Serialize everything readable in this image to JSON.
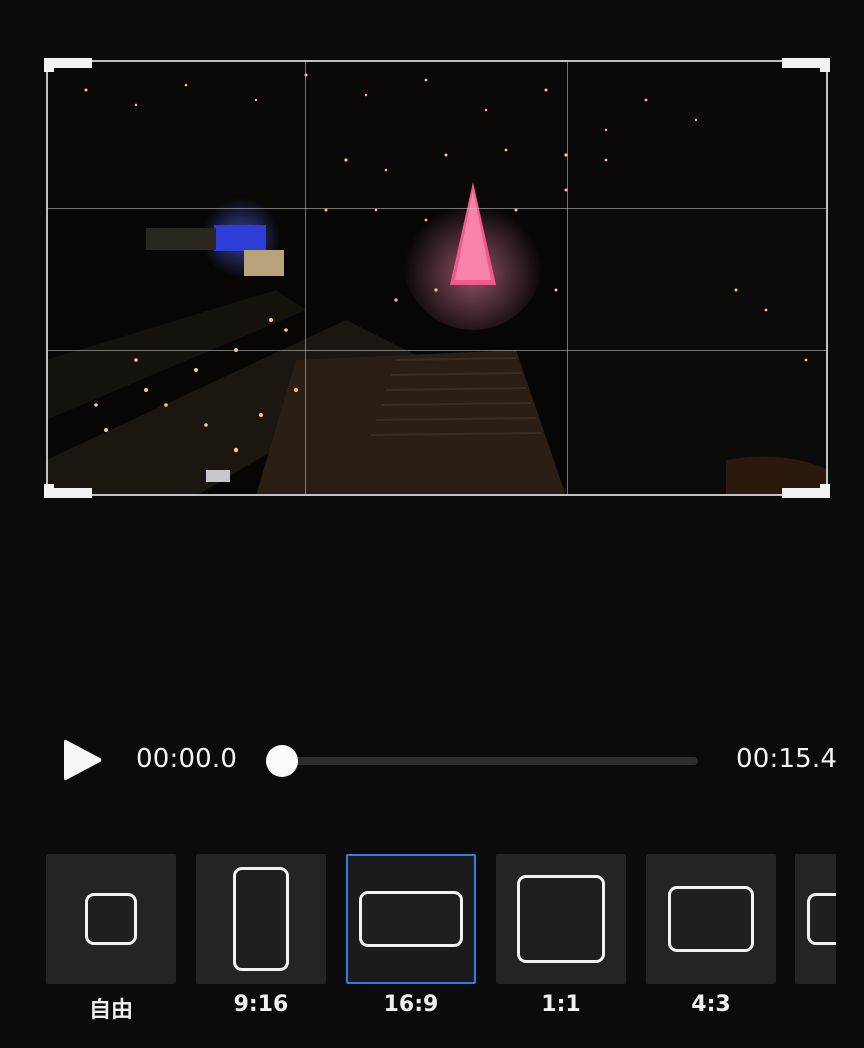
{
  "player": {
    "current_time": "00:00.0",
    "total_time": "00:15.4",
    "progress_fraction": 0.0,
    "play_icon": "play-icon"
  },
  "video": {
    "description": "night aerial city view with lit christmas tree"
  },
  "crop": {
    "grid": "3x3",
    "selected_ratio": "16:9"
  },
  "ratios": [
    {
      "label": "自由",
      "icon": "free-ratio-icon"
    },
    {
      "label": "9:16",
      "icon": "portrait-9-16-icon"
    },
    {
      "label": "16:9",
      "icon": "landscape-16-9-icon"
    },
    {
      "label": "1:1",
      "icon": "square-1-1-icon"
    },
    {
      "label": "4:3",
      "icon": "landscape-4-3-icon"
    },
    {
      "label": "",
      "icon": "partial-ratio-icon"
    }
  ],
  "colors": {
    "background": "#0b0b0b",
    "tile": "#242424",
    "selected_border": "#2f7fe0",
    "crop_border": "#e1e1e1"
  }
}
